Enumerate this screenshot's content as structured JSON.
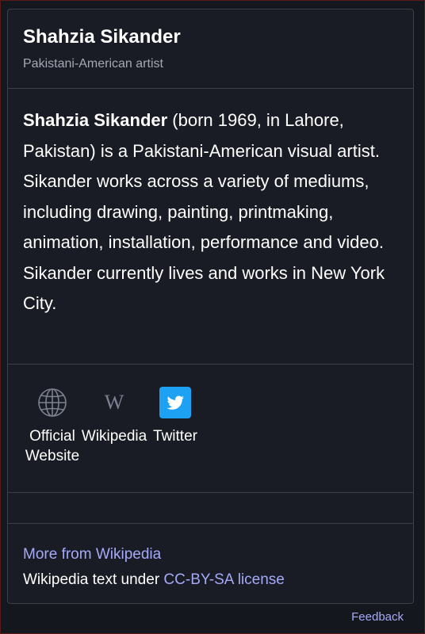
{
  "header": {
    "title": "Shahzia Sikander",
    "subtitle": "Pakistani-American artist"
  },
  "abstract": {
    "name_bold": "Shahzia Sikander",
    "text": " (born 1969, in Lahore, Pakistan) is a Pakistani-American visual artist. Sikander works across a variety of mediums, including drawing, painting, printmaking, animation, installation, performance and video. Sikander currently lives and works in New York City."
  },
  "links": [
    {
      "label": "Official Website",
      "icon": "globe-icon"
    },
    {
      "label": "Wikipedia",
      "icon": "wikipedia-icon"
    },
    {
      "label": "Twitter",
      "icon": "twitter-icon"
    }
  ],
  "footer": {
    "more_link": "More from Wikipedia",
    "license_prefix": "Wikipedia text under ",
    "license_link": "CC-BY-SA license"
  },
  "feedback": "Feedback",
  "colors": {
    "background": "#15171f",
    "panel": "#1a1c25",
    "border": "#3a3f4a",
    "link": "#a5a9f7",
    "twitter_blue": "#1da1f2",
    "muted": "#a4a8b4"
  }
}
